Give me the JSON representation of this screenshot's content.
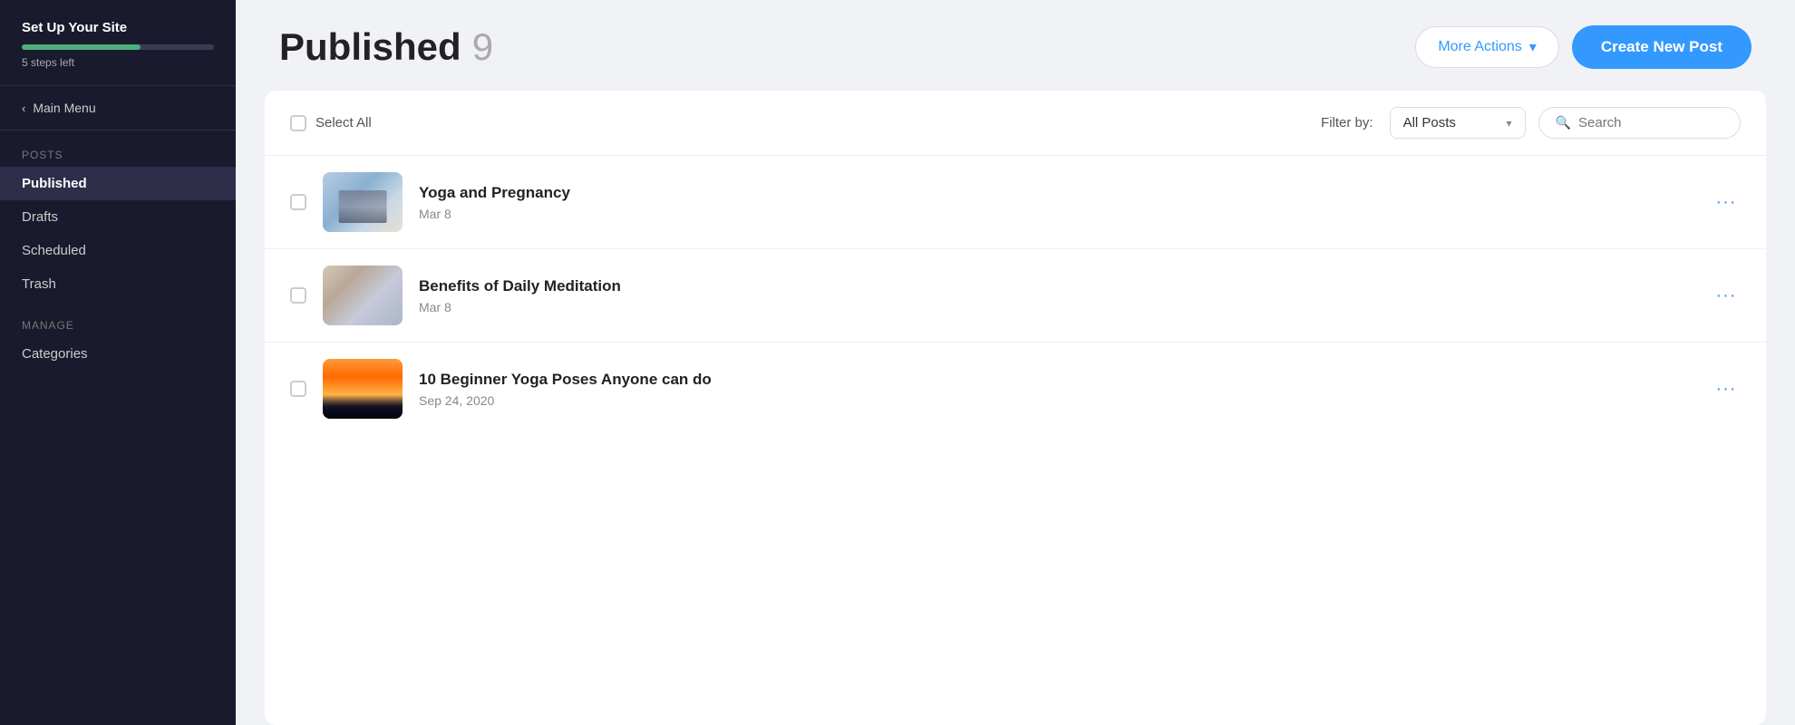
{
  "sidebar": {
    "setup_title": "Set Up Your Site",
    "steps_left": "5 steps left",
    "progress_percent": 62,
    "main_menu_label": "Main Menu",
    "posts_section_label": "Posts",
    "nav_items": [
      {
        "id": "published",
        "label": "Published",
        "active": true
      },
      {
        "id": "drafts",
        "label": "Drafts",
        "active": false
      },
      {
        "id": "scheduled",
        "label": "Scheduled",
        "active": false
      },
      {
        "id": "trash",
        "label": "Trash",
        "active": false
      }
    ],
    "manage_section_label": "Manage",
    "manage_items": [
      {
        "id": "categories",
        "label": "Categories"
      }
    ]
  },
  "header": {
    "page_title": "Published",
    "post_count": "9",
    "more_actions_label": "More Actions",
    "create_new_post_label": "Create New Post"
  },
  "toolbar": {
    "select_all_label": "Select All",
    "filter_label": "Filter by:",
    "filter_value": "All Posts",
    "search_placeholder": "Search"
  },
  "posts": [
    {
      "title": "Yoga and Pregnancy",
      "date": "Mar 8",
      "thumb_type": "yoga1"
    },
    {
      "title": "Benefits of Daily Meditation",
      "date": "Mar 8",
      "thumb_type": "meditation"
    },
    {
      "title": "10 Beginner Yoga Poses Anyone can do",
      "date": "Sep 24, 2020",
      "thumb_type": "sunset"
    }
  ],
  "icons": {
    "chevron_left": "‹",
    "chevron_down": "▾",
    "search": "🔍",
    "ellipsis": "···"
  }
}
